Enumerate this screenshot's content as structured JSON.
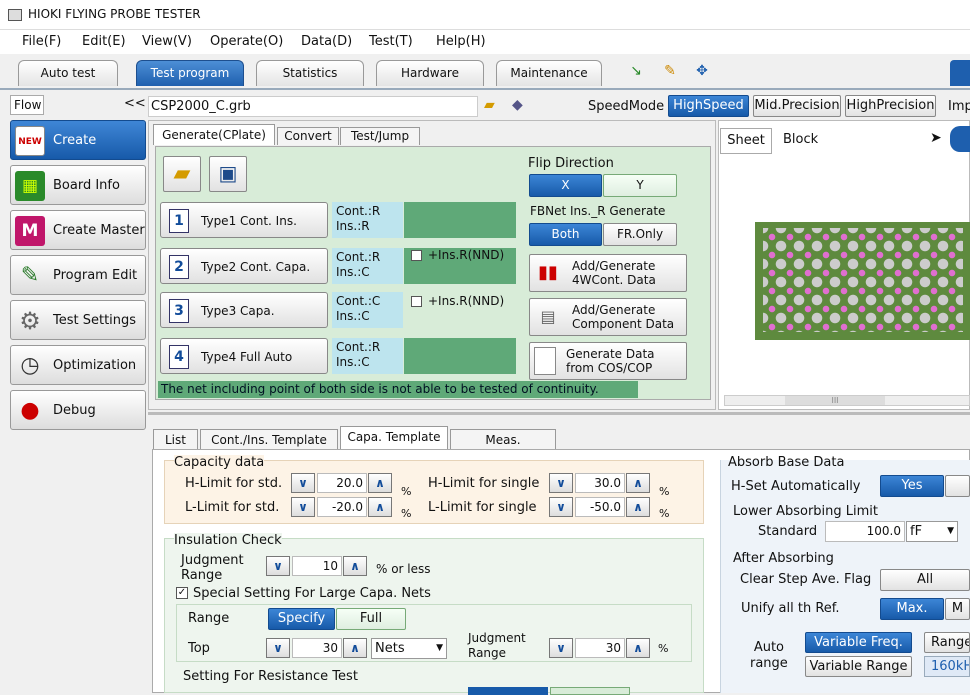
{
  "window": {
    "title": "HIOKI FLYING PROBE TESTER"
  },
  "menu": [
    "File(F)",
    "Edit(E)",
    "View(V)",
    "Operate(O)",
    "Data(D)",
    "Test(T)",
    "Help(H)"
  ],
  "main_tabs": [
    "Auto test",
    "Test program",
    "Statistics",
    "Hardware",
    "Maintenance"
  ],
  "flow": {
    "label": "Flow",
    "collapse": "<<",
    "file": "CSP2000_C.grb"
  },
  "nav": [
    "Create",
    "Board Info",
    "Create Master",
    "Program Edit",
    "Test Settings",
    "Optimization",
    "Debug"
  ],
  "speed": {
    "label": "SpeedMode",
    "options": [
      "HighSpeed",
      "Mid.Precision",
      "HighPrecision"
    ],
    "extra": "Imp"
  },
  "subtabs": [
    "Generate(CPlate)",
    "Convert",
    "Test/Jump"
  ],
  "types": [
    {
      "num": "1",
      "label": "Type1 Cont. Ins.",
      "info1": "Cont.:R",
      "info2": "Ins.:R",
      "extra": ""
    },
    {
      "num": "2",
      "label": "Type2 Cont. Capa.",
      "info1": "Cont.:R",
      "info2": "Ins.:C",
      "extra": "+Ins.R(NND)"
    },
    {
      "num": "3",
      "label": "Type3 Capa.",
      "info1": "Cont.:C",
      "info2": "Ins.:C",
      "extra": "+Ins.R(NND)"
    },
    {
      "num": "4",
      "label": "Type4 Full Auto",
      "info1": "Cont.:R",
      "info2": "Ins.:C",
      "extra": ""
    }
  ],
  "flip": {
    "label": "Flip Direction",
    "x": "X",
    "y": "Y"
  },
  "fbnet": {
    "label": "FBNet Ins._R Generate",
    "both": "Both",
    "fr": "FR.Only"
  },
  "actions": [
    {
      "l1": "Add/Generate",
      "l2": "4WCont. Data"
    },
    {
      "l1": "Add/Generate",
      "l2": "Component Data"
    },
    {
      "l1": "Generate Data",
      "l2": "from COS/COP"
    }
  ],
  "warning": "The net including point of both side is not able to be tested of continuity.",
  "sheet": {
    "tab1": "Sheet",
    "tab2": "Block"
  },
  "scroll_mark": "III",
  "lower_tabs": [
    "List",
    "Cont./Ins. Template",
    "Capa. Template",
    "Meas. Template"
  ],
  "capacity": {
    "title": "Capacity data",
    "h_std_label": "H-Limit for std.",
    "h_std": "20.0",
    "l_std_label": "L-Limit for std.",
    "l_std": "-20.0",
    "h_single_label": "H-Limit for single",
    "h_single": "30.0",
    "l_single_label": "L-Limit for single",
    "l_single": "-50.0",
    "unit": "%"
  },
  "insulation": {
    "title": "Insulation Check",
    "judg_label1": "Judgment",
    "judg_label2": "Range",
    "judg": "10",
    "suffix": "% or less",
    "special_label": "Special Setting For Large Capa. Nets",
    "range_label": "Range",
    "specify": "Specify",
    "full": "Full",
    "top_label": "Top",
    "top": "30",
    "nets": "Nets",
    "jr1": "Judgment",
    "jr2": "Range",
    "jr": "30",
    "unit": "%"
  },
  "resistance": {
    "title": "Setting For Resistance Test"
  },
  "absorb": {
    "title": "Absorb Base Data",
    "hset_label": "H-Set Automatically",
    "yes": "Yes",
    "lower_title": "Lower Absorbing Limit",
    "std_label": "Standard",
    "std": "100.0",
    "unit": "fF",
    "after_title": "After Absorbing",
    "clear_label": "Clear Step Ave. Flag",
    "all": "All",
    "unify_label": "Unify all th Ref.",
    "max": "Max.",
    "auto1": "Auto",
    "auto2": "range",
    "varfreq": "Variable Freq.",
    "varrange": "Variable Range",
    "range": "Range",
    "freq": "160kH"
  }
}
